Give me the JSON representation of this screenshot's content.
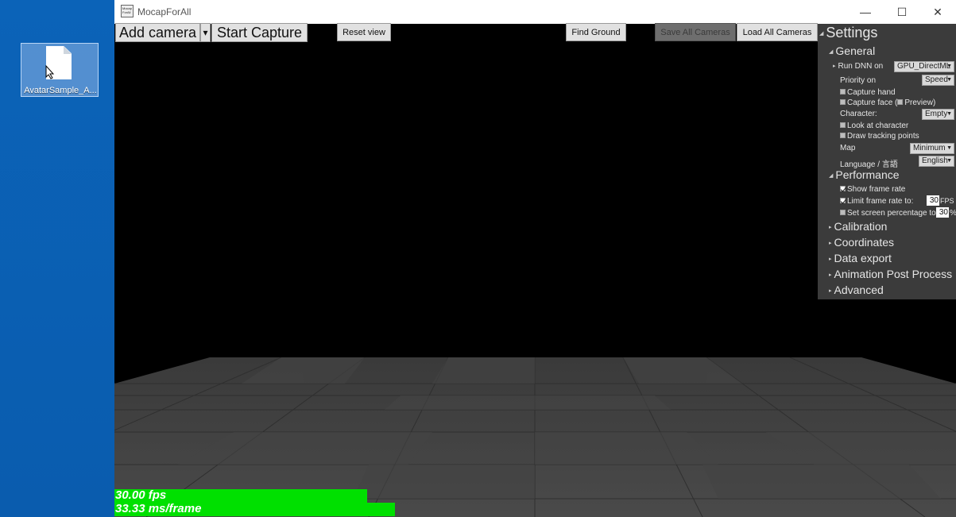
{
  "desktop": {
    "icon_label": "AvatarSample_A..."
  },
  "window": {
    "app_icon_text": "Mocap ForAll",
    "title": "MocapForAll",
    "controls": {
      "minimize": "—",
      "maximize": "☐",
      "close": "✕"
    }
  },
  "toolbar": {
    "add_camera": "Add camera",
    "add_camera_dropdown": "▾",
    "start_capture": "Start Capture",
    "reset_view": "Reset view",
    "find_ground": "Find Ground",
    "save_all_cameras": "Save All Cameras",
    "load_all_cameras": "Load All Cameras"
  },
  "settings": {
    "title": "Settings",
    "general": {
      "header": "General",
      "run_dnn_label": "Run DNN on",
      "run_dnn_value": "GPU_DirectML",
      "priority_label": "Priority on",
      "priority_value": "Speed",
      "capture_hand": "Capture hand",
      "capture_face": "Capture face (",
      "preview": "Preview)",
      "character_label": "Character:",
      "character_value": "Empty",
      "look_at_character": "Look at character",
      "draw_tracking_points": "Draw tracking points",
      "map_label": "Map",
      "map_value": "Minimum",
      "language_label": "Language / 言語",
      "language_value": "English"
    },
    "performance": {
      "header": "Performance",
      "show_frame_rate": "Show frame rate",
      "show_frame_rate_checked": true,
      "limit_frame_rate": "Limit frame rate to:",
      "limit_frame_rate_checked": true,
      "limit_value": "30",
      "limit_unit": "FPS",
      "screen_percentage": "Set screen percentage to:",
      "screen_percentage_checked": false,
      "screen_percentage_value": "30",
      "screen_percentage_unit": "%"
    },
    "sections": [
      "Calibration",
      "Coordinates",
      "Data export",
      "Animation Post Process",
      "Advanced"
    ]
  },
  "stats": {
    "fps": "30.00 fps",
    "ms_per_frame": "33.33 ms/frame"
  },
  "colors": {
    "desktop": "#0a5fb4",
    "stats_bar": "#00e000",
    "panel": "#3b3b3b"
  }
}
